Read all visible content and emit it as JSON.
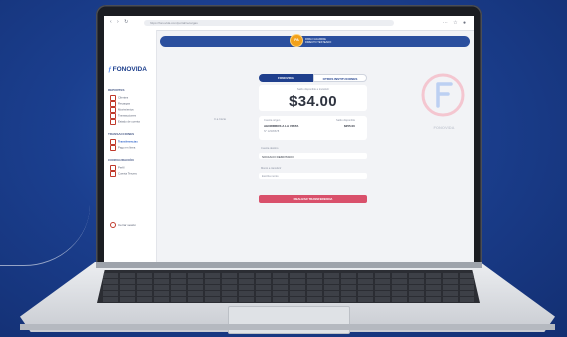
{
  "app": {
    "logo_text": "FONOVIDA",
    "browser_url": "https://fonovida.com/portal/recargas",
    "nav_glyphs": "‹ › ↻",
    "browser_icons": "⋯ ☆ ●"
  },
  "user": {
    "initials": "PA",
    "name": "PABLO AGUIRRE",
    "subtitle": "DIRECTO TESTEADO"
  },
  "sidebar": {
    "sections": [
      {
        "title": "REPORTES",
        "items": [
          "Clientes",
          "Recargas",
          "Movimientos",
          "Transacciones",
          "Estado de cuenta"
        ]
      },
      {
        "title": "TRANSACCIONES",
        "items": [
          "Transferencias",
          "Pago en línea"
        ]
      },
      {
        "title": "CONFIGURACIÓN",
        "items": [
          "Perfil",
          "Cuenta Tercero"
        ]
      }
    ],
    "active_item": "Transferencias",
    "logout_label": "Cerrar sesión"
  },
  "side_link": "Ir a Inicio",
  "tabs": {
    "active": "FONOVIDA",
    "inactive": "OTROS INSTITUCIONES"
  },
  "balance": {
    "label": "Saldo disponible a transferir",
    "amount": "$34.00"
  },
  "detail": {
    "left_title": "Cuenta origen",
    "left_value": "AHORRROS A LA VISTA",
    "left_sub": "N° 12345678",
    "right_title": "Saldo disponible",
    "right_value": "$255.00"
  },
  "form": {
    "dest_label": "Cuenta destino",
    "dest_value": "SOCIACO DEMOTADO",
    "amount_label": "Monto a transferir",
    "amount_placeholder": "Escriba monto"
  },
  "submit_label": "REALIZAR TRANSFERENCIA",
  "brand_watermark": "FONOVIDA",
  "colors": {
    "background": "#1b3f8f",
    "accent": "#2b4f9e",
    "button": "#d9506b",
    "avatar": "#f2a11b"
  }
}
